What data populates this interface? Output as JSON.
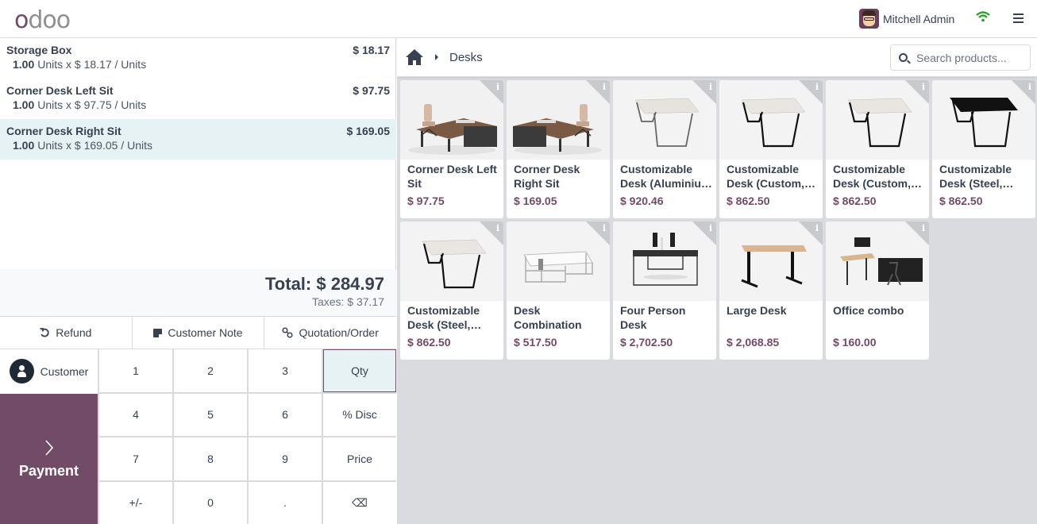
{
  "header": {
    "logo": "odoo",
    "user_name": "Mitchell Admin",
    "status_icon": "wifi-icon",
    "menu_icon": "hamburger-icon"
  },
  "order": {
    "lines": [
      {
        "name": "Storage Box",
        "price": "$ 18.17",
        "qty": "1.00",
        "detail": "Units x $ 18.17 / Units",
        "selected": false
      },
      {
        "name": "Corner Desk Left Sit",
        "price": "$ 97.75",
        "qty": "1.00",
        "detail": "Units x $ 97.75 / Units",
        "selected": false
      },
      {
        "name": "Corner Desk Right Sit",
        "price": "$ 169.05",
        "qty": "1.00",
        "detail": "Units x $ 169.05 / Units",
        "selected": true
      }
    ],
    "total": "Total: $ 284.97",
    "taxes": "Taxes: $ 37.17"
  },
  "controls": {
    "refund": "Refund",
    "customer_note": "Customer Note",
    "quotation": "Quotation/Order"
  },
  "pad": {
    "customer": "Customer",
    "payment": "Payment",
    "keys": [
      "1",
      "2",
      "3",
      "Qty",
      "4",
      "5",
      "6",
      "% Disc",
      "7",
      "8",
      "9",
      "Price",
      "+/-",
      "0",
      ".",
      "⌫"
    ],
    "active_mode": "Qty"
  },
  "catalog": {
    "breadcrumb": "Desks",
    "search_placeholder": "Search products...",
    "info_label": "i",
    "products": [
      {
        "name": "Corner Desk Left Sit",
        "price": "$ 97.75",
        "img": "corner-left"
      },
      {
        "name": "Corner Desk Right Sit",
        "price": "$ 169.05",
        "img": "corner-right"
      },
      {
        "name": "Customizable Desk (Aluminiu…",
        "price": "$ 920.46",
        "img": "table-alu"
      },
      {
        "name": "Customizable Desk (Custom,…",
        "price": "$ 862.50",
        "img": "table-black-legs"
      },
      {
        "name": "Customizable Desk (Custom,…",
        "price": "$ 862.50",
        "img": "table-black-legs"
      },
      {
        "name": "Customizable Desk (Steel,…",
        "price": "$ 862.50",
        "img": "table-black"
      },
      {
        "name": "Customizable Desk (Steel,…",
        "price": "$ 862.50",
        "img": "table-black-legs"
      },
      {
        "name": "Desk Combination",
        "price": "$ 517.50",
        "img": "desk-combo"
      },
      {
        "name": "Four Person Desk",
        "price": "$ 2,702.50",
        "img": "four-person"
      },
      {
        "name": "Large Desk",
        "price": "$ 2,068.85",
        "img": "large-desk"
      },
      {
        "name": "Office combo",
        "price": "$ 160.00",
        "img": "office-combo"
      }
    ]
  },
  "colors": {
    "brand": "#714b67",
    "selected_bg": "#e6f2f3",
    "wifi": "#1aa31a",
    "catalog_bg": "#dadbdf"
  }
}
